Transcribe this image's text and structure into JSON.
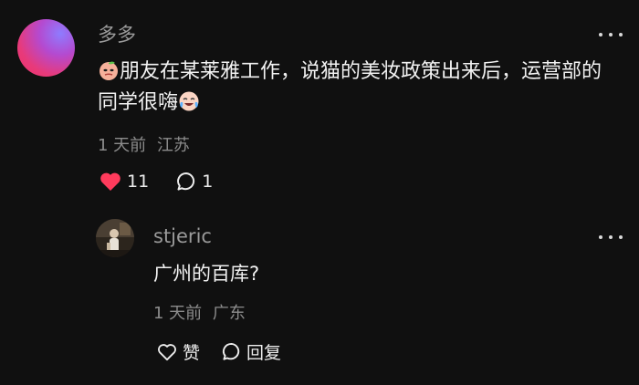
{
  "main_comment": {
    "username": "多多",
    "text_before_emoji": "朋友在某莱雅工作，说猫的美妆政策出来后，运营部的同学很嗨",
    "leading_emoji": "peach-face-emoji",
    "trailing_emoji": "crying-laughing-emoji",
    "time": "1 天前",
    "location": "江苏",
    "like_count": "11",
    "reply_count": "1",
    "like_color": "#ff3b5c"
  },
  "reply_comment": {
    "username": "stjeric",
    "text": "广州的百库?",
    "time": "1 天前",
    "location": "广东",
    "like_label": "赞",
    "reply_label": "回复"
  }
}
